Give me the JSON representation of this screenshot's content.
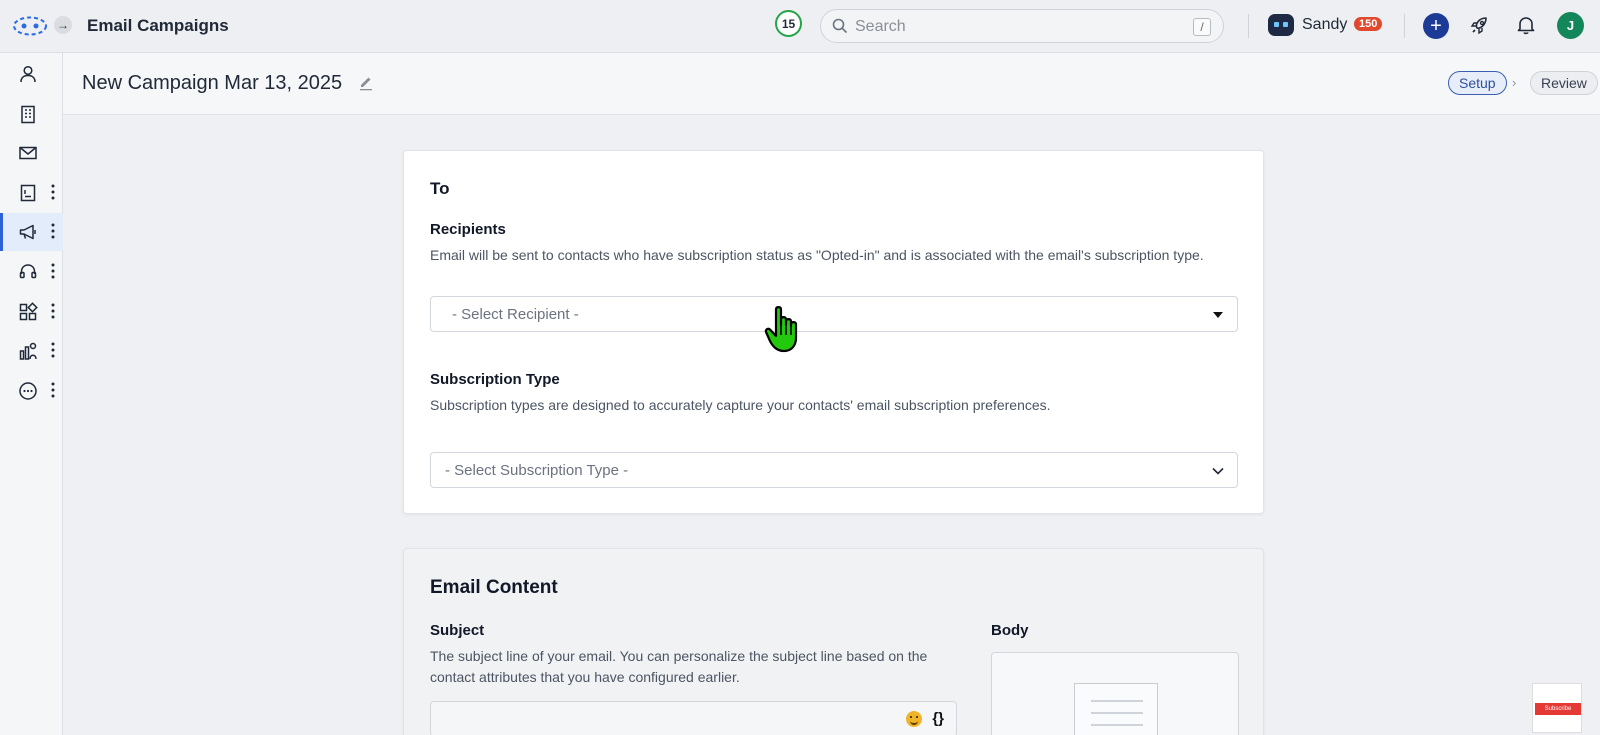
{
  "header": {
    "app_title": "Email Campaigns",
    "notification_count": "15",
    "search_placeholder": "Search",
    "search_shortcut": "/",
    "user_name": "Sandy",
    "credit_badge": "150",
    "avatar_initial": "J"
  },
  "rail": {
    "icons": [
      "contacts-icon",
      "companies-icon",
      "mail-icon",
      "notebook-icon",
      "megaphone-icon",
      "headset-icon",
      "apps-icon",
      "analytics-icon",
      "more-icon"
    ],
    "active": "megaphone-icon"
  },
  "subheader": {
    "campaign_title": "New Campaign Mar 13, 2025",
    "steps": [
      "Setup",
      "Review"
    ],
    "active_step": "Setup"
  },
  "to_section": {
    "title": "To",
    "recipients_label": "Recipients",
    "recipients_desc": "Email will be sent to contacts who have subscription status as \"Opted-in\" and is associated with the email's subscription type.",
    "recipient_placeholder": "- Select Recipient -",
    "subscription_label": "Subscription Type",
    "subscription_desc": "Subscription types are designed to accurately capture your contacts' email subscription preferences.",
    "subscription_placeholder": "- Select Subscription Type -"
  },
  "content_section": {
    "title": "Email Content",
    "subject_label": "Subject",
    "subject_desc": "The subject line of your email. You can personalize the subject line based on the contact attributes that you have configured earlier.",
    "subject_value": "",
    "placeholder_token": "{}",
    "body_label": "Body"
  },
  "watermark": {
    "subscribe": "Subscribe"
  },
  "colors": {
    "accent": "#2c62d6",
    "notification_ring": "#22a447",
    "credit_badge": "#e0492d",
    "plus_button": "#1d3a96",
    "avatar": "#14875a",
    "cursor": "#22c90c"
  }
}
